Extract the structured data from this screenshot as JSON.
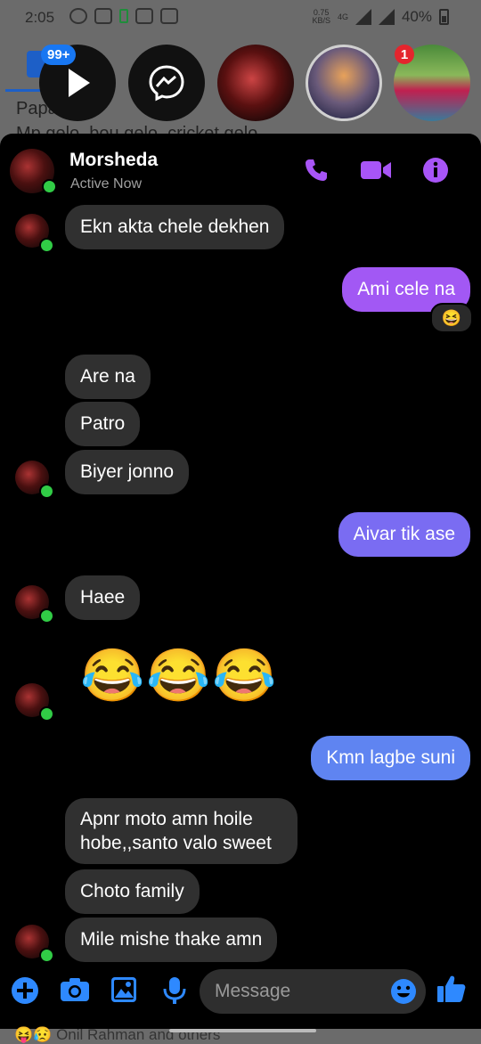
{
  "status_bar": {
    "time": "2:05",
    "net_speed_value": "0.75",
    "net_speed_unit": "KB/S",
    "network": "4G",
    "battery": "40%"
  },
  "background": {
    "preview_line1": "Papa    na",
    "preview_line2": "Mp gelo, bou gelo, cricket gelo",
    "bottom_text": "Onil Rahman and others",
    "unread_badge": "99+",
    "story_badge": "1"
  },
  "header": {
    "name": "Morsheda",
    "status": "Active Now"
  },
  "messages": [
    {
      "text": "Ekn akta chele dekhen",
      "dir": "in"
    },
    {
      "text": "Ami cele na",
      "dir": "out"
    },
    {
      "text": "Are na",
      "dir": "in"
    },
    {
      "text": "Patro",
      "dir": "in"
    },
    {
      "text": "Biyer jonno",
      "dir": "in"
    },
    {
      "text": "Aivar tik ase",
      "dir": "out"
    },
    {
      "text": "Haee",
      "dir": "in"
    },
    {
      "text": "😂😂😂",
      "dir": "in"
    },
    {
      "text": "Kmn lagbe suni",
      "dir": "out"
    },
    {
      "text": "Apnr moto amn hoile hobe,,santo valo sweet",
      "dir": "in"
    },
    {
      "text": "Choto family",
      "dir": "in"
    },
    {
      "text": "Mile mishe thake amn",
      "dir": "in"
    }
  ],
  "reaction": "😆",
  "composer": {
    "placeholder": "Message"
  },
  "colors": {
    "accent_purple": "#a855f7",
    "accent_blue": "#2e89ff",
    "bubble_in": "#303030",
    "bubble_out_1": "#a258f4",
    "bubble_out_2": "#7a6cf2",
    "bubble_out_3": "#5f84f1",
    "online": "#31cc46"
  },
  "icons": [
    "phone-icon",
    "video-icon",
    "info-icon",
    "plus-icon",
    "camera-icon",
    "image-icon",
    "mic-icon",
    "emoji-icon",
    "thumbs-up-icon"
  ]
}
